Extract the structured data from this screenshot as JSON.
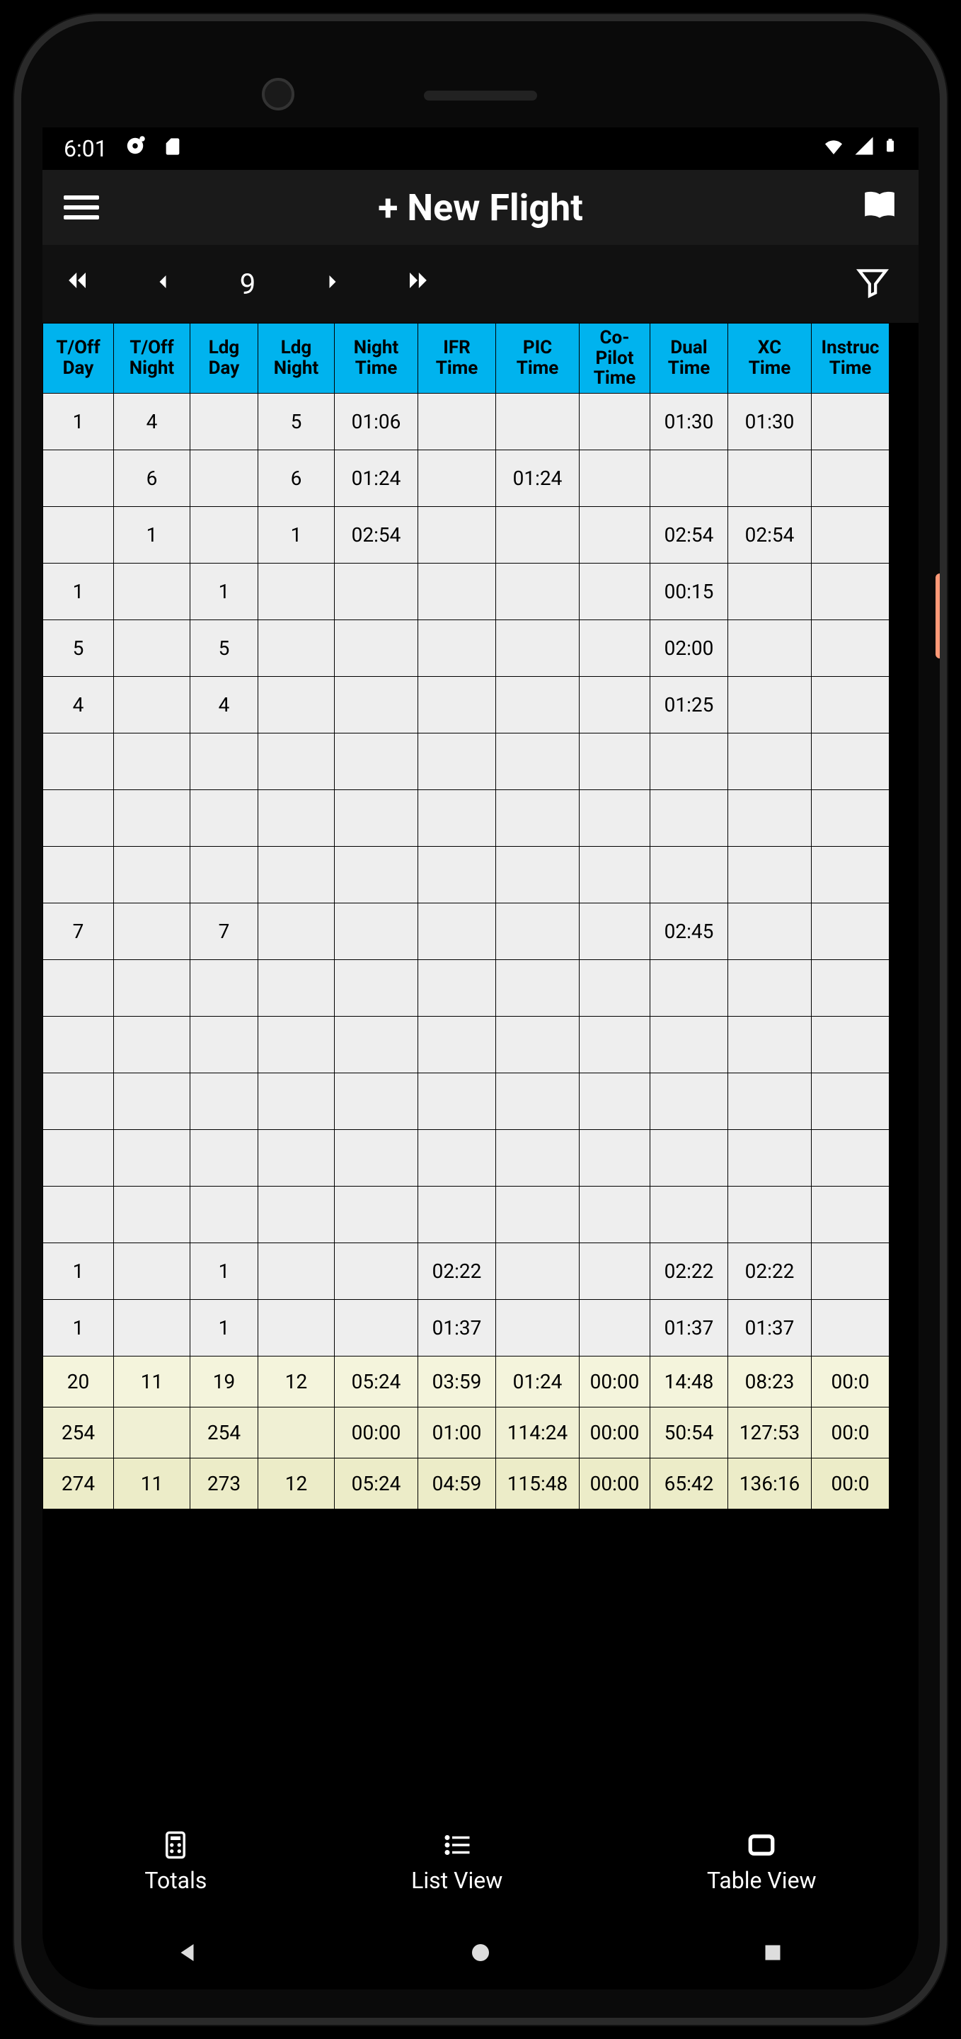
{
  "status": {
    "time": "6:01"
  },
  "header": {
    "title": "+ New Flight"
  },
  "nav": {
    "page": "9"
  },
  "columns": [
    "T/Off Day",
    "T/Off Night",
    "Ldg Day",
    "Ldg Night",
    "Night Time",
    "IFR Time",
    "PIC Time",
    "Co-Pilot Time",
    "Dual Time",
    "XC Time",
    "Instruc Time"
  ],
  "rows": [
    [
      "1",
      "4",
      "",
      "5",
      "01:06",
      "",
      "",
      "",
      "01:30",
      "01:30",
      ""
    ],
    [
      "",
      "6",
      "",
      "6",
      "01:24",
      "",
      "01:24",
      "",
      "",
      "",
      ""
    ],
    [
      "",
      "1",
      "",
      "1",
      "02:54",
      "",
      "",
      "",
      "02:54",
      "02:54",
      ""
    ],
    [
      "1",
      "",
      "1",
      "",
      "",
      "",
      "",
      "",
      "00:15",
      "",
      ""
    ],
    [
      "5",
      "",
      "5",
      "",
      "",
      "",
      "",
      "",
      "02:00",
      "",
      ""
    ],
    [
      "4",
      "",
      "4",
      "",
      "",
      "",
      "",
      "",
      "01:25",
      "",
      ""
    ],
    [
      "",
      "",
      "",
      "",
      "",
      "",
      "",
      "",
      "",
      "",
      ""
    ],
    [
      "",
      "",
      "",
      "",
      "",
      "",
      "",
      "",
      "",
      "",
      ""
    ],
    [
      "",
      "",
      "",
      "",
      "",
      "",
      "",
      "",
      "",
      "",
      ""
    ],
    [
      "7",
      "",
      "7",
      "",
      "",
      "",
      "",
      "",
      "02:45",
      "",
      ""
    ],
    [
      "",
      "",
      "",
      "",
      "",
      "",
      "",
      "",
      "",
      "",
      ""
    ],
    [
      "",
      "",
      "",
      "",
      "",
      "",
      "",
      "",
      "",
      "",
      ""
    ],
    [
      "",
      "",
      "",
      "",
      "",
      "",
      "",
      "",
      "",
      "",
      ""
    ],
    [
      "",
      "",
      "",
      "",
      "",
      "",
      "",
      "",
      "",
      "",
      ""
    ],
    [
      "",
      "",
      "",
      "",
      "",
      "",
      "",
      "",
      "",
      "",
      ""
    ],
    [
      "1",
      "",
      "1",
      "",
      "",
      "02:22",
      "",
      "",
      "02:22",
      "02:22",
      ""
    ],
    [
      "1",
      "",
      "1",
      "",
      "",
      "01:37",
      "",
      "",
      "01:37",
      "01:37",
      ""
    ]
  ],
  "totals": [
    [
      "20",
      "11",
      "19",
      "12",
      "05:24",
      "03:59",
      "01:24",
      "00:00",
      "14:48",
      "08:23",
      "00:0"
    ],
    [
      "254",
      "",
      "254",
      "",
      "00:00",
      "01:00",
      "114:24",
      "00:00",
      "50:54",
      "127:53",
      "00:0"
    ],
    [
      "274",
      "11",
      "273",
      "12",
      "05:24",
      "04:59",
      "115:48",
      "00:00",
      "65:42",
      "136:16",
      "00:0"
    ]
  ],
  "tabs": {
    "totals": "Totals",
    "list": "List View",
    "table": "Table View"
  }
}
